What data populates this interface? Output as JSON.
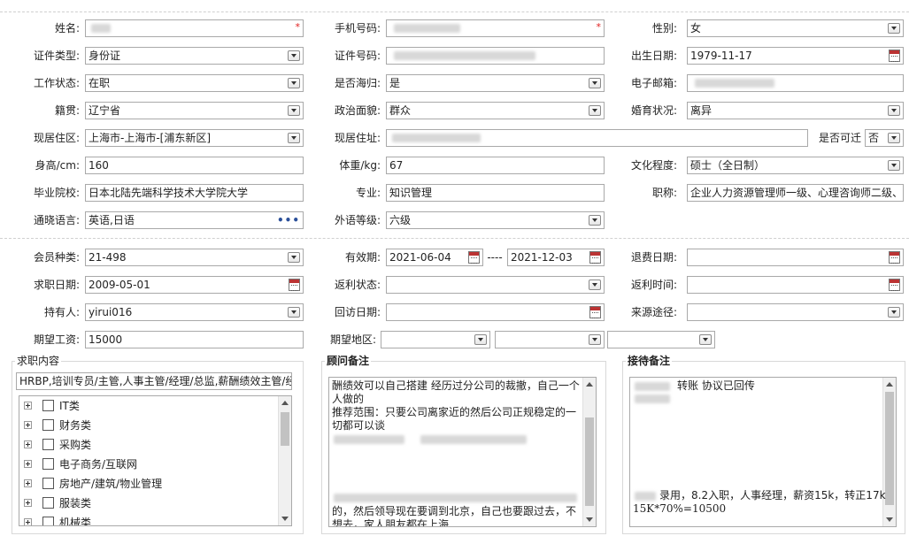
{
  "basic": {
    "name_label": "姓名:",
    "phone_label": "手机号码:",
    "gender_label": "性别:",
    "gender_value": "女",
    "id_type_label": "证件类型:",
    "id_type_value": "身份证",
    "id_number_label": "证件号码:",
    "birth_label": "出生日期:",
    "birth_value": "1979-11-17",
    "work_status_label": "工作状态:",
    "work_status_value": "在职",
    "overseas_label": "是否海归:",
    "overseas_value": "是",
    "email_label": "电子邮箱:",
    "native_label": "籍贯:",
    "native_value": "辽宁省",
    "political_label": "政治面貌:",
    "political_value": "群众",
    "marital_label": "婚育状况:",
    "marital_value": "离异",
    "residence_area_label": "现居住区:",
    "residence_area_value": "上海市-上海市-[浦东新区]",
    "address_label": "现居住址:",
    "relocate_label": "是否可迁",
    "relocate_value": "否",
    "height_label": "身高/cm:",
    "height_value": "160",
    "weight_label": "体重/kg:",
    "weight_value": "67",
    "education_label": "文化程度:",
    "education_value": "硕士（全日制）",
    "school_label": "毕业院校:",
    "school_value": "日本北陆先端科学技术大学院大学",
    "major_label": "专业:",
    "major_value": "知识管理",
    "title_label": "职称:",
    "title_value": "企业人力资源管理师一级、心理咨询师二级、",
    "language_label": "通晓语言:",
    "language_value": "英语,日语",
    "language_more": "•••",
    "lang_level_label": "外语等级:",
    "lang_level_value": "六级"
  },
  "member": {
    "type_label": "会员种类:",
    "type_value": "21-498",
    "valid_label": "有效期:",
    "valid_from": "2021-06-04",
    "valid_sep": "----",
    "valid_to": "2021-12-03",
    "refund_date_label": "退费日期:",
    "job_date_label": "求职日期:",
    "job_date_value": "2009-05-01",
    "rebate_status_label": "返利状态:",
    "rebate_time_label": "返利时间:",
    "holder_label": "持有人:",
    "holder_value": "yirui016",
    "visit_label": "回访日期:",
    "source_label": "来源途径:",
    "salary_label": "期望工资:",
    "salary_value": "15000",
    "region_label": "期望地区:"
  },
  "job_content": {
    "title": "求职内容",
    "summary": "HRBP,培训专员/主管,人事主管/经理/总监,薪酬绩效主管/经",
    "tree": [
      {
        "label": "IT类"
      },
      {
        "label": "财务类"
      },
      {
        "label": "采购类"
      },
      {
        "label": "电子商务/互联网"
      },
      {
        "label": "房地产/建筑/物业管理"
      },
      {
        "label": "服装类"
      },
      {
        "label": "机械类"
      }
    ]
  },
  "consultant": {
    "title": "顾问备注",
    "line1": "酬绩效可以自己搭建  经历过分公司的裁撤，自己一个人做的",
    "line2": "推荐范围：只要公司离家近的然后公司正规稳定的一切都可以谈",
    "line3": "的，然后领导现在要调到北京，自己也要跟过去，不想去，家人朋友都在上海"
  },
  "reception": {
    "title": "接待备注",
    "line1": "转账  协议已回传",
    "line2": "录用，8.2入职，人事经理，薪资15k，转正17k",
    "line3": "15K*70%=10500"
  }
}
